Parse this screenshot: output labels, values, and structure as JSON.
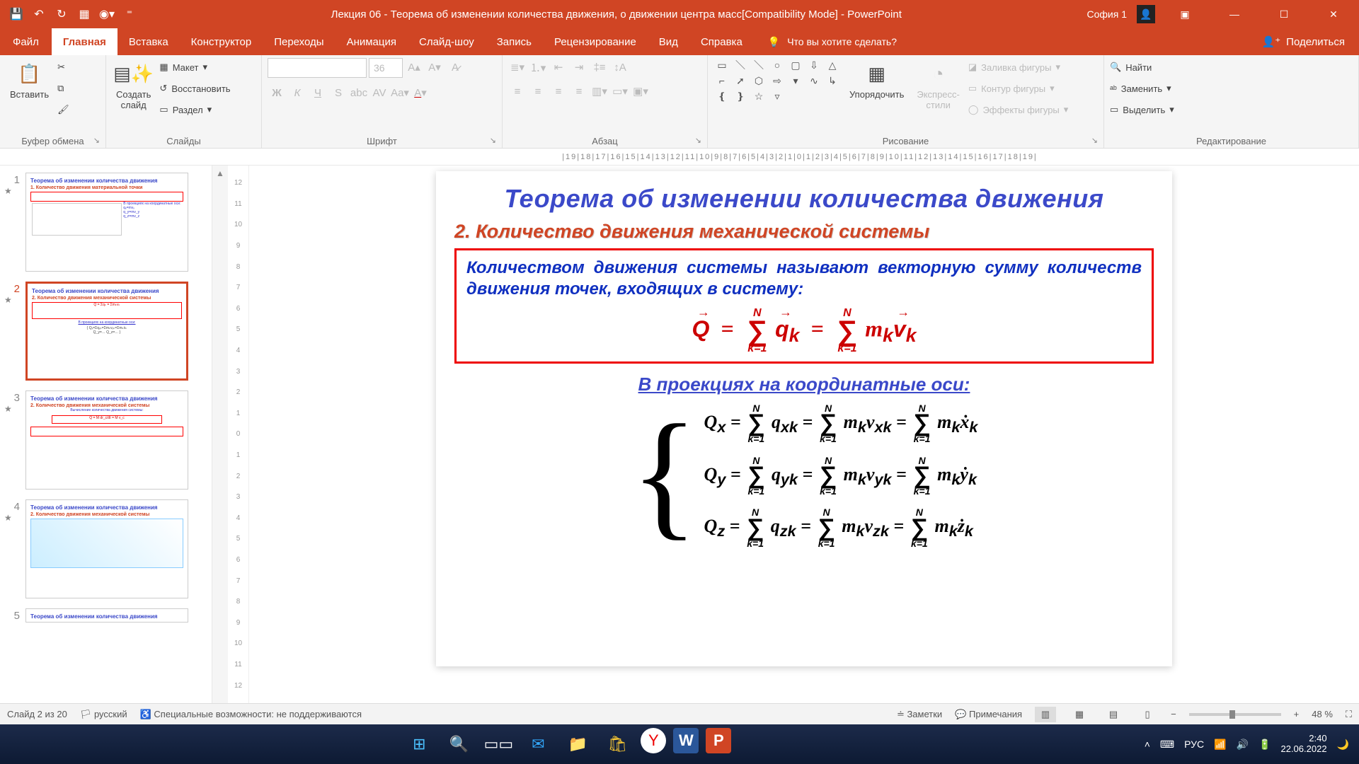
{
  "titlebar": {
    "doc_title": "Лекция 06 - Теорема об изменении количества движения, о движении центра масс[Compatibility Mode]  -  PowerPoint",
    "user": "София 1"
  },
  "tabs": {
    "file": "Файл",
    "home": "Главная",
    "insert": "Вставка",
    "design": "Конструктор",
    "transitions": "Переходы",
    "animations": "Анимация",
    "slideshow": "Слайд-шоу",
    "record": "Запись",
    "review": "Рецензирование",
    "view": "Вид",
    "help": "Справка",
    "tellme": "Что вы хотите сделать?",
    "share": "Поделиться"
  },
  "ribbon": {
    "clipboard": {
      "paste": "Вставить",
      "label": "Буфер обмена"
    },
    "slides": {
      "new": "Создать\nслайд",
      "layout": "Макет",
      "reset": "Восстановить",
      "section": "Раздел",
      "label": "Слайды"
    },
    "font": {
      "size": "36",
      "label": "Шрифт"
    },
    "paragraph": {
      "label": "Абзац"
    },
    "drawing": {
      "arrange": "Упорядочить",
      "quick": "Экспресс-\nстили",
      "fill": "Заливка фигуры",
      "outline": "Контур фигуры",
      "effects": "Эффекты фигуры",
      "label": "Рисование"
    },
    "editing": {
      "find": "Найти",
      "replace": "Заменить",
      "select": "Выделить",
      "label": "Редактирование"
    }
  },
  "thumbs": {
    "n1": "1",
    "n2": "2",
    "n3": "3",
    "n4": "4",
    "n5": "5",
    "mini_title": "Теорема об изменении количества движения",
    "mini_sub1": "1. Количество движения материальной точки",
    "mini_sub2": "2. Количество движения механической системы"
  },
  "slide": {
    "title": "Теорема об изменении количества движения",
    "subtitle": "2.  Количество движения механической системы",
    "definition": "Количеством движения системы называют векторную сумму количеств движения точек, входящих в систему:",
    "proj_head": "В проекциях на координатные оси:"
  },
  "statusbar": {
    "slide_of": "Слайд 2 из 20",
    "lang": "русский",
    "access": "Специальные возможности: не поддерживаются",
    "notes": "Заметки",
    "comments": "Примечания",
    "zoom": "48 %"
  },
  "taskbar": {
    "lang": "РУС",
    "time": "2:40",
    "date": "22.06.2022"
  }
}
